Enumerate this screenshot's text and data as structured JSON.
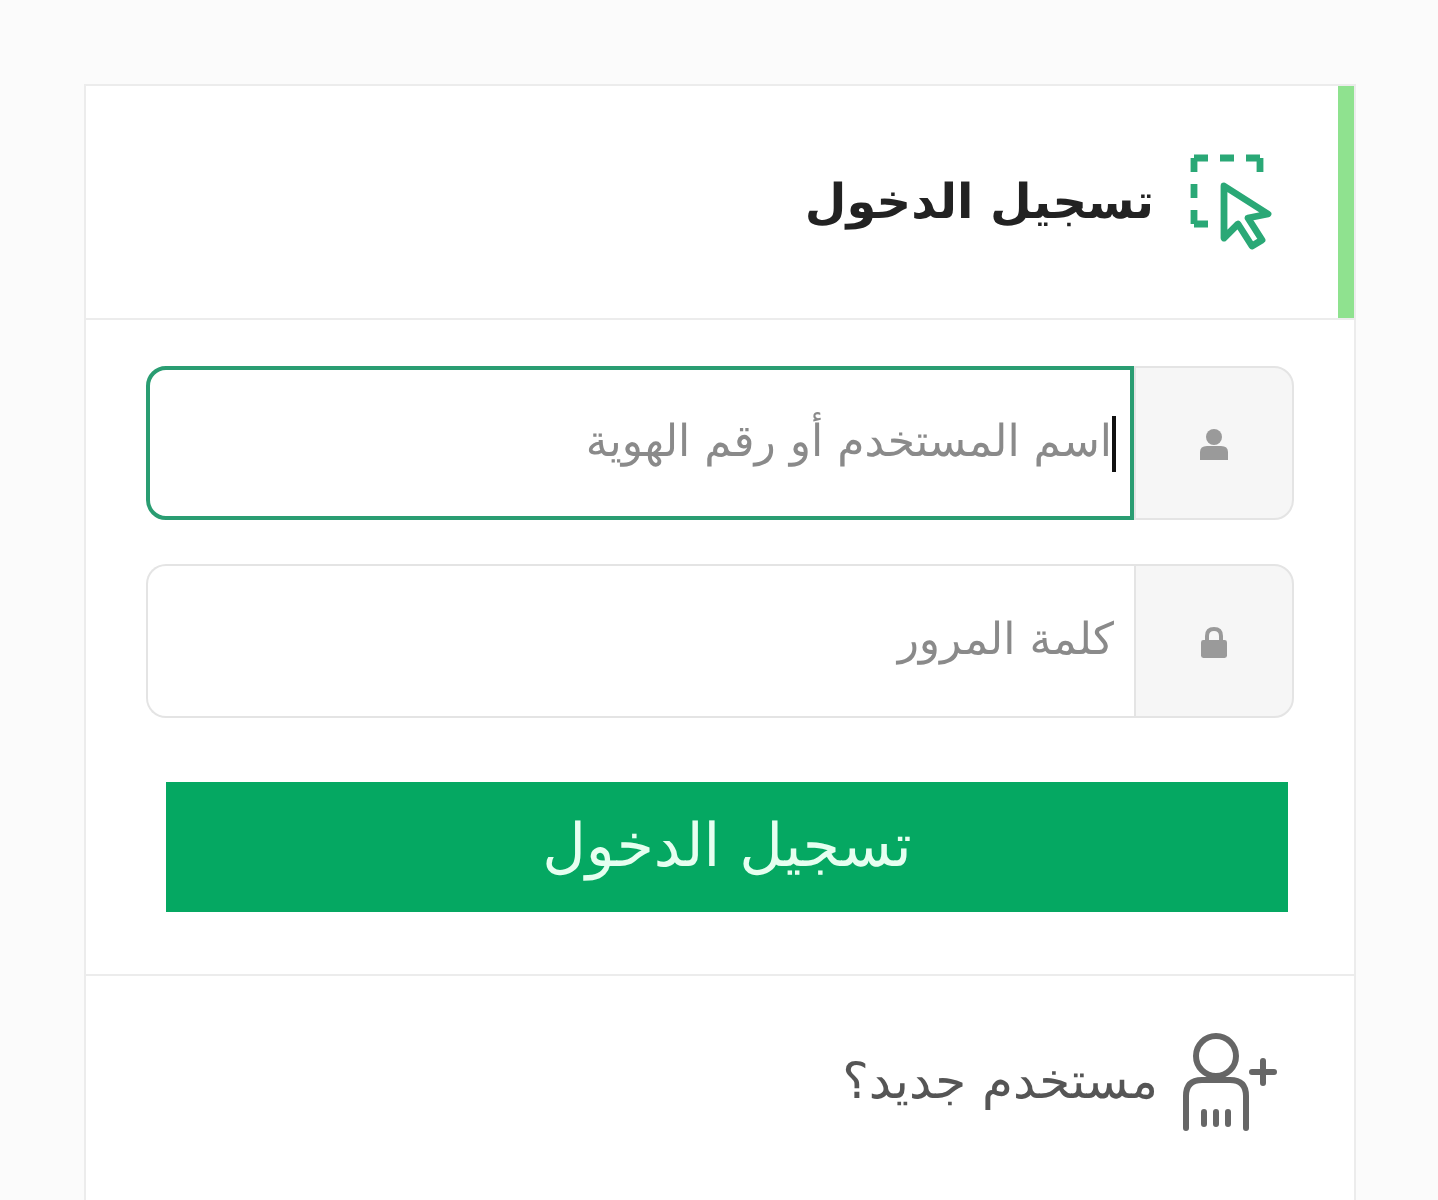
{
  "header": {
    "title": "تسجيل الدخول"
  },
  "fields": [
    {
      "kind": "text",
      "placeholder": "اسم المستخدم أو رقم الهوية",
      "focused": true
    },
    {
      "kind": "password",
      "placeholder": "كلمة المرور",
      "focused": false
    }
  ],
  "submit_button": {
    "label": "تسجيل الدخول"
  },
  "register_link": {
    "label": "مستخدم جديد؟"
  }
}
